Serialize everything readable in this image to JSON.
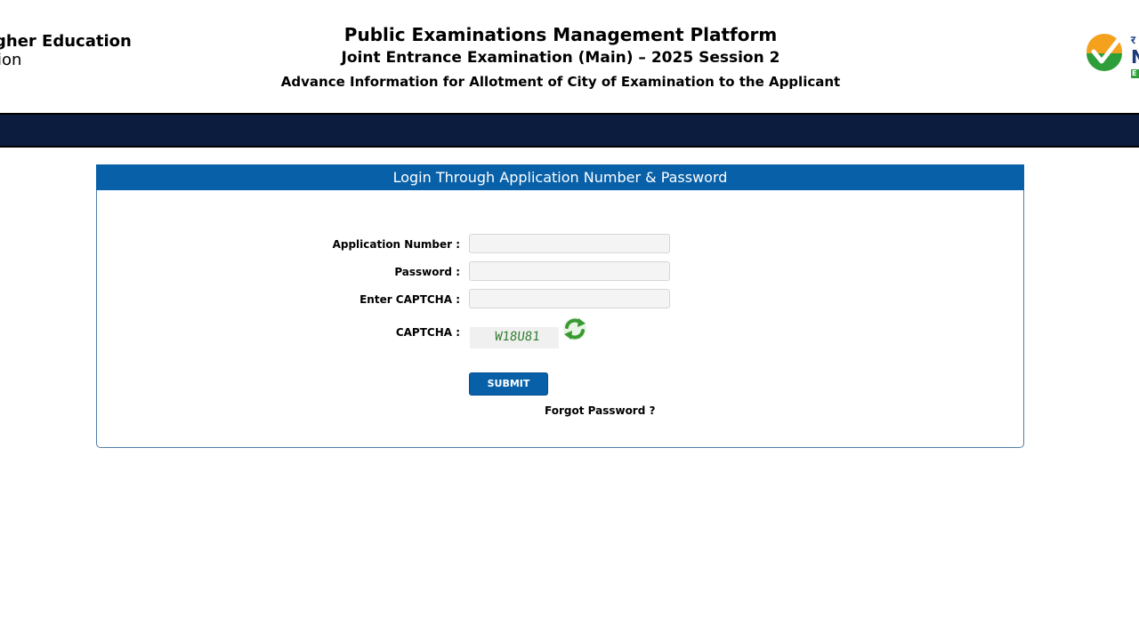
{
  "header": {
    "dept_line1": "gher Education",
    "dept_line2": "ion",
    "title": "Public Examinations Management Platform",
    "subtitle": "Joint Entrance Examination (Main) – 2025 Session 2",
    "info": "Advance Information for Allotment of City of Examination to the Applicant",
    "logo": {
      "icon": "nta-logo-icon",
      "hindi_text": "र",
      "letter": "N",
      "strip_text": "E",
      "orange": "#f4a11d",
      "green": "#2e9e3a"
    }
  },
  "navbar": {
    "color": "#0c1c3e"
  },
  "login": {
    "heading": "Login Through Application Number & Password",
    "fields": {
      "application_number": {
        "label": "Application Number :",
        "value": "",
        "placeholder": ""
      },
      "password": {
        "label": "Password :",
        "value": "",
        "placeholder": ""
      },
      "captcha_input": {
        "label": "Enter CAPTCHA :",
        "value": "",
        "placeholder": ""
      }
    },
    "captcha": {
      "label": "CAPTCHA :",
      "text": "W18U81",
      "refresh_icon": "refresh-icon"
    },
    "submit_label": "SUBMIT",
    "forgot_label": "Forgot Password ?",
    "accent": "#0860a8"
  }
}
